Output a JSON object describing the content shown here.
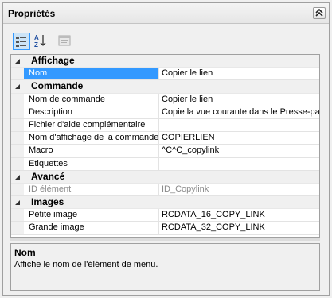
{
  "panel": {
    "title": "Propriétés"
  },
  "toolbar": {
    "categorized_icon": "categorized-view-icon",
    "alphabetical_icon": "sort-az-icon",
    "property_pages_icon": "property-pages-icon"
  },
  "grid": {
    "categories": [
      {
        "label": "Affichage",
        "rows": [
          {
            "name": "Nom",
            "value": "Copier le lien",
            "selected": true
          }
        ]
      },
      {
        "label": "Commande",
        "rows": [
          {
            "name": "Nom de commande",
            "value": "Copier le lien"
          },
          {
            "name": "Description",
            "value": "Copie la vue courante dans le Presse-papiers"
          },
          {
            "name": "Fichier d'aide complémentaire",
            "value": ""
          },
          {
            "name": "Nom d'affichage de la commande",
            "value": "COPIERLIEN"
          },
          {
            "name": "Macro",
            "value": "^C^C_copylink"
          },
          {
            "name": "Etiquettes",
            "value": ""
          }
        ]
      },
      {
        "label": "Avancé",
        "rows": [
          {
            "name": "ID élément",
            "value": "ID_Copylink",
            "disabled": true
          }
        ]
      },
      {
        "label": "Images",
        "rows": [
          {
            "name": "Petite image",
            "value": "RCDATA_16_COPY_LINK"
          },
          {
            "name": "Grande image",
            "value": "RCDATA_32_COPY_LINK"
          }
        ]
      }
    ]
  },
  "description": {
    "title": "Nom",
    "text": "Affiche le nom de l'élément de menu."
  },
  "colors": {
    "selection": "#3399ff",
    "category_bg": "#f0f0f0",
    "border": "#a0a0a0"
  }
}
